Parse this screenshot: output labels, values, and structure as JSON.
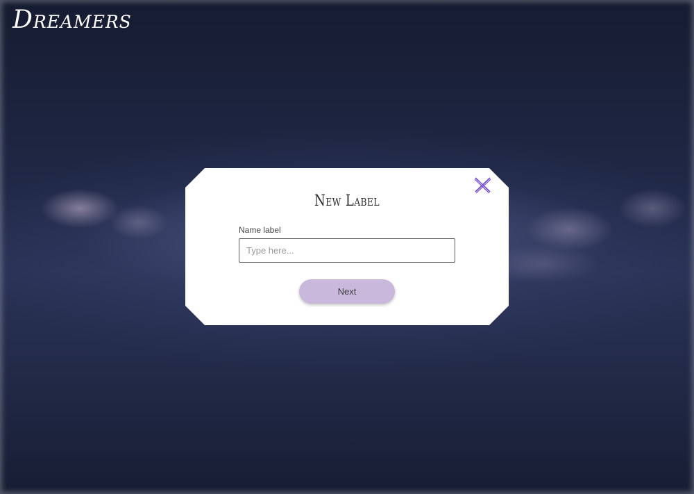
{
  "app": {
    "logo_text": "Dreamers"
  },
  "modal": {
    "title": "New Label",
    "field_label": "Name label",
    "input_value": "",
    "input_placeholder": "Type here...",
    "next_label": "Next",
    "close_icon": "close-icon"
  },
  "colors": {
    "accent": "#c9b8dc",
    "close_icon": "#6a3fd6",
    "modal_bg": "#ffffff",
    "page_bg": "#1c2340"
  }
}
